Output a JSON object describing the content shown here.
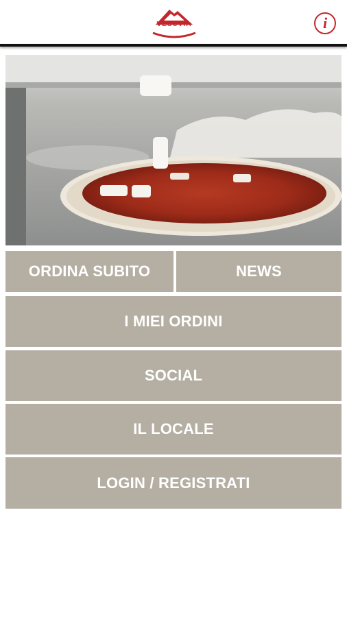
{
  "header": {
    "logo_text": "VESUVIA",
    "info_icon": "info-icon",
    "brand_color": "#c3262b"
  },
  "menu": {
    "ordina_subito": "ORDINA SUBITO",
    "news": "NEWS",
    "miei_ordini": "I MIEI ORDINI",
    "social": "SOCIAL",
    "il_locale": "IL LOCALE",
    "login": "LOGIN / REGISTRATI",
    "tile_color": "#b5afa3"
  }
}
